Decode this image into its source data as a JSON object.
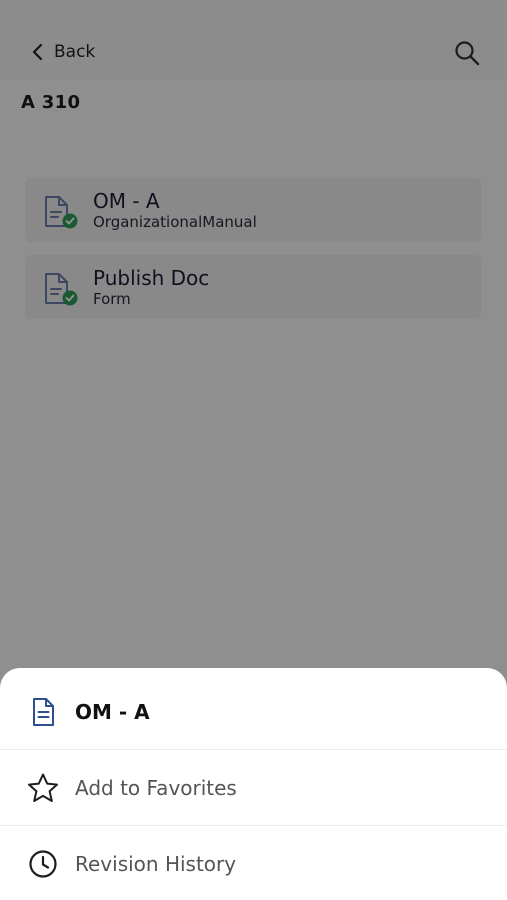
{
  "header": {
    "back_label": "Back",
    "folder_title": "A 310"
  },
  "documents": [
    {
      "title": "OM - A",
      "subtitle": "OrganizationalManual"
    },
    {
      "title": "Publish Doc",
      "subtitle": "Form"
    }
  ],
  "sheet": {
    "title": "OM - A",
    "actions": [
      {
        "label": "Add to Favorites",
        "icon": "star-icon"
      },
      {
        "label": "Revision History",
        "icon": "clock-icon"
      }
    ]
  },
  "colors": {
    "overlay": "rgba(0,0,0,0.42)",
    "doc_icon": "#6b7aa8",
    "check_badge": "#2e9b57",
    "sheet_doc_icon": "#2f4f8f"
  }
}
